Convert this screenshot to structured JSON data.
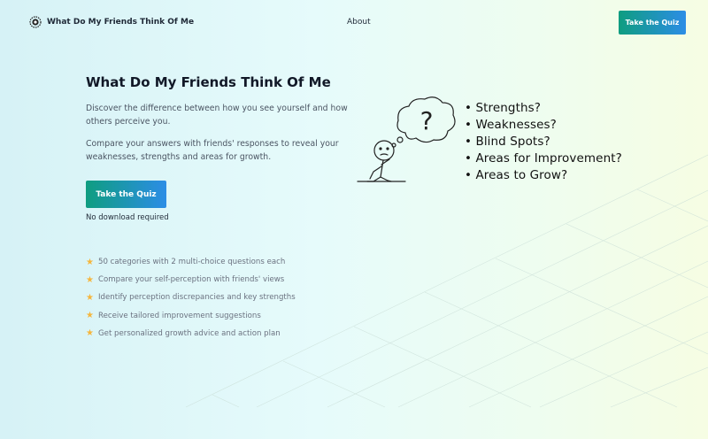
{
  "nav": {
    "brand": "What Do My Friends Think Of Me",
    "links": [
      "About"
    ],
    "cta": "Take the Quiz"
  },
  "hero": {
    "title": "What Do My Friends Think Of Me",
    "paragraphs": [
      "Discover the difference between how you see yourself and how others perceive you.",
      "Compare your answers with friends' responses to reveal your weaknesses, strengths and areas for growth."
    ],
    "cta": "Take the Quiz",
    "note": "No download required"
  },
  "features": [
    "50 categories with 2 multi-choice questions each",
    "Compare your self-perception with friends' views",
    "Identify perception discrepancies and key strengths",
    "Receive tailored improvement suggestions",
    "Get personalized growth advice and action plan"
  ],
  "illustration": {
    "thought_bubble": "?",
    "questions": [
      "• Strengths?",
      "• Weaknesses?",
      "• Blind Spots?",
      "• Areas for Improvement?",
      "• Areas to Grow?"
    ]
  },
  "icons": {
    "logo": "brain-logo-icon",
    "feature_bullet": "star-icon"
  },
  "colors": {
    "button_gradient_start": "#0f9d80",
    "button_gradient_end": "#2c8de6",
    "star": "#f5b63d"
  }
}
